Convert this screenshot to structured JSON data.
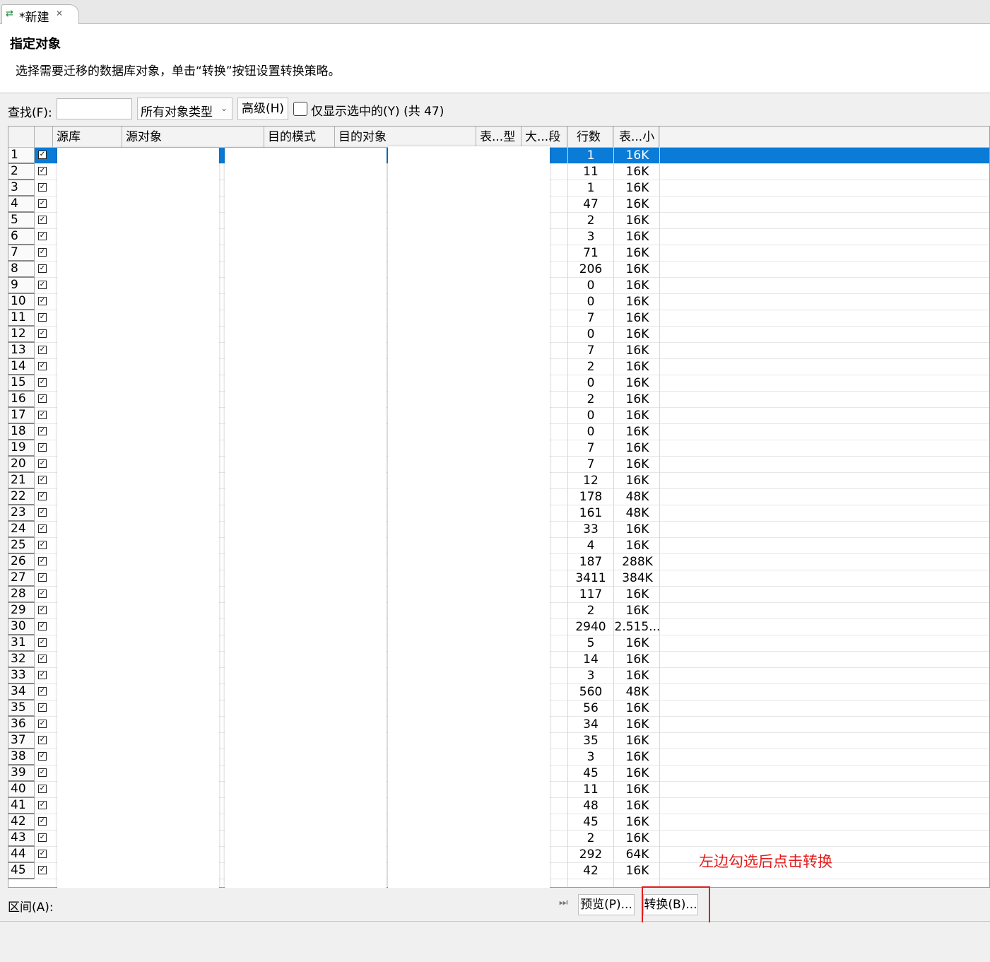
{
  "tab": {
    "title": "*新建",
    "icon": "migrate-arrows-icon",
    "close": "✕"
  },
  "header": {
    "title": "指定对象",
    "description": "选择需要迁移的数据库对象，单击“转换”按钮设置转换策略。"
  },
  "toolbar": {
    "find_label": "查找(F):",
    "find_value": "",
    "type_select": "所有对象类型",
    "advanced_button": "高级(H)",
    "only_selected_label": "仅显示选中的(Y)",
    "total": "(共 47)"
  },
  "columns": [
    "源库",
    "源对象",
    "目的模式",
    "目的对象",
    "表...型",
    "大...段",
    "行数",
    "表...小"
  ],
  "rows": [
    {
      "n": "1",
      "rows": "1",
      "size": "16K"
    },
    {
      "n": "2",
      "rows": "11",
      "size": "16K"
    },
    {
      "n": "3",
      "rows": "1",
      "size": "16K"
    },
    {
      "n": "4",
      "rows": "47",
      "size": "16K"
    },
    {
      "n": "5",
      "rows": "2",
      "size": "16K"
    },
    {
      "n": "6",
      "rows": "3",
      "size": "16K"
    },
    {
      "n": "7",
      "rows": "71",
      "size": "16K"
    },
    {
      "n": "8",
      "rows": "206",
      "size": "16K"
    },
    {
      "n": "9",
      "rows": "0",
      "size": "16K"
    },
    {
      "n": "10",
      "rows": "0",
      "size": "16K"
    },
    {
      "n": "11",
      "rows": "7",
      "size": "16K"
    },
    {
      "n": "12",
      "rows": "0",
      "size": "16K"
    },
    {
      "n": "13",
      "rows": "7",
      "size": "16K"
    },
    {
      "n": "14",
      "rows": "2",
      "size": "16K"
    },
    {
      "n": "15",
      "rows": "0",
      "size": "16K"
    },
    {
      "n": "16",
      "rows": "2",
      "size": "16K"
    },
    {
      "n": "17",
      "rows": "0",
      "size": "16K"
    },
    {
      "n": "18",
      "rows": "0",
      "size": "16K"
    },
    {
      "n": "19",
      "rows": "7",
      "size": "16K"
    },
    {
      "n": "20",
      "rows": "7",
      "size": "16K"
    },
    {
      "n": "21",
      "rows": "12",
      "size": "16K"
    },
    {
      "n": "22",
      "rows": "178",
      "size": "48K"
    },
    {
      "n": "23",
      "rows": "161",
      "size": "48K"
    },
    {
      "n": "24",
      "rows": "33",
      "size": "16K"
    },
    {
      "n": "25",
      "rows": "4",
      "size": "16K"
    },
    {
      "n": "26",
      "rows": "187",
      "size": "288K"
    },
    {
      "n": "27",
      "rows": "3411",
      "size": "384K"
    },
    {
      "n": "28",
      "rows": "117",
      "size": "16K"
    },
    {
      "n": "29",
      "rows": "2",
      "size": "16K"
    },
    {
      "n": "30",
      "rows": "2940",
      "size": "2.515..."
    },
    {
      "n": "31",
      "rows": "5",
      "size": "16K"
    },
    {
      "n": "32",
      "rows": "14",
      "size": "16K"
    },
    {
      "n": "33",
      "rows": "3",
      "size": "16K"
    },
    {
      "n": "34",
      "rows": "560",
      "size": "48K"
    },
    {
      "n": "35",
      "rows": "56",
      "size": "16K"
    },
    {
      "n": "36",
      "rows": "34",
      "size": "16K"
    },
    {
      "n": "37",
      "rows": "35",
      "size": "16K"
    },
    {
      "n": "38",
      "rows": "3",
      "size": "16K"
    },
    {
      "n": "39",
      "rows": "45",
      "size": "16K"
    },
    {
      "n": "40",
      "rows": "11",
      "size": "16K"
    },
    {
      "n": "41",
      "rows": "48",
      "size": "16K"
    },
    {
      "n": "42",
      "rows": "45",
      "size": "16K"
    },
    {
      "n": "43",
      "rows": "2",
      "size": "16K"
    },
    {
      "n": "44",
      "rows": "292",
      "size": "64K"
    },
    {
      "n": "45",
      "rows": "42",
      "size": "16K"
    }
  ],
  "selected_row": 1,
  "bottom": {
    "range_label": "区间(A):",
    "preview_button": "预览(P)...",
    "convert_button": "转换(B)..."
  },
  "annotation": "左边勾选后点击转换",
  "colors": {
    "selection": "#0a7bd7",
    "annotation": "#e31c1c"
  }
}
